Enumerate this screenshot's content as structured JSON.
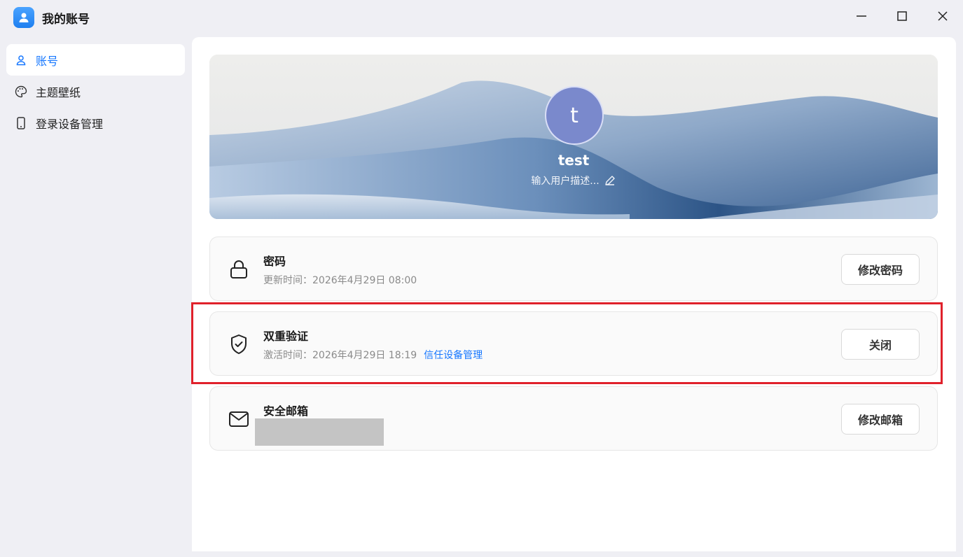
{
  "window": {
    "title": "我的账号",
    "icons": {
      "app": "user-icon",
      "minimize": "minimize-icon",
      "maximize": "maximize-icon",
      "close": "close-icon"
    }
  },
  "sidebar": {
    "items": [
      {
        "label": "账号",
        "icon": "user-icon",
        "active": true
      },
      {
        "label": "主题壁纸",
        "icon": "palette-icon",
        "active": false
      },
      {
        "label": "登录设备管理",
        "icon": "phone-icon",
        "active": false
      }
    ]
  },
  "profile": {
    "avatar_letter": "t",
    "username": "test",
    "description_placeholder": "输入用户描述...",
    "edit_icon": "pencil-icon"
  },
  "cards": {
    "password": {
      "icon": "lock-icon",
      "title": "密码",
      "subtitle": "更新时间：2026年4月29日 08:00",
      "button": "修改密码"
    },
    "two_factor": {
      "icon": "shield-check-icon",
      "title": "双重验证",
      "subtitle": "激活时间：2026年4月29日 18:19",
      "link": "信任设备管理",
      "button": "关闭"
    },
    "email": {
      "icon": "mail-icon",
      "title": "安全邮箱",
      "value_redacted": true,
      "button": "修改邮箱"
    }
  },
  "colors": {
    "accent": "#1677ff",
    "avatar_bg": "#7a89cc",
    "highlight_border": "#e0212b"
  }
}
